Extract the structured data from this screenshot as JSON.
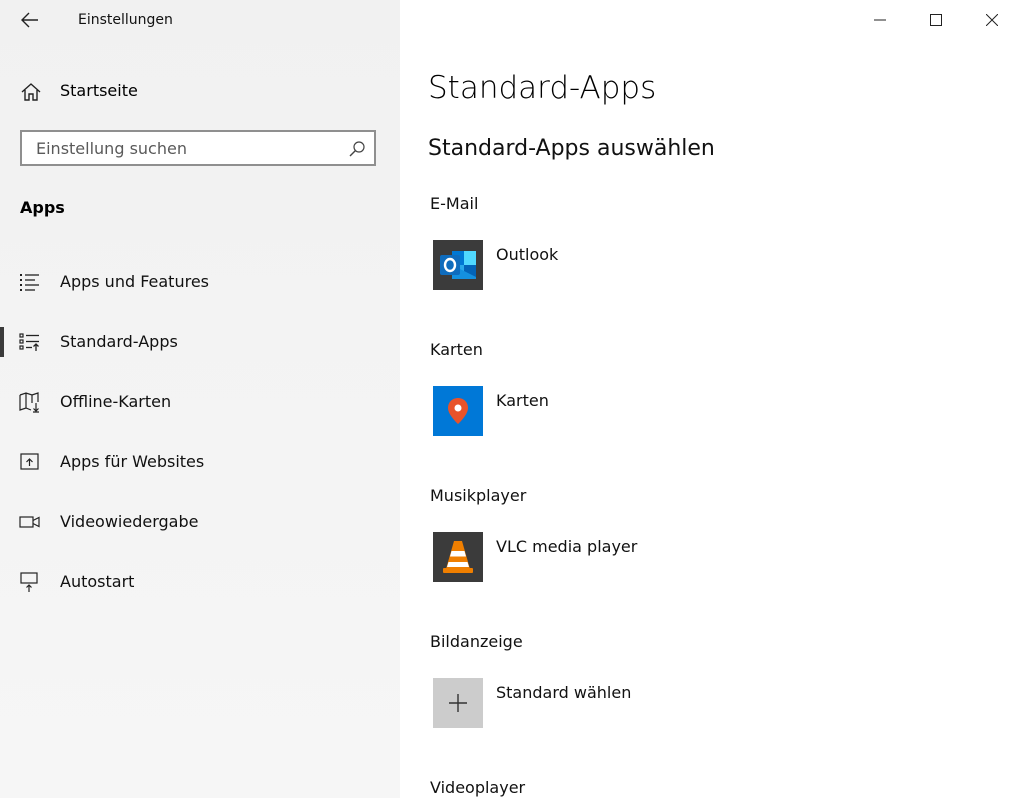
{
  "window": {
    "title": "Einstellungen"
  },
  "sidebar": {
    "home_label": "Startseite",
    "search_placeholder": "Einstellung suchen",
    "section_title": "Apps",
    "items": [
      {
        "label": "Apps und Features",
        "icon": "list-icon",
        "active": false
      },
      {
        "label": "Standard-Apps",
        "icon": "default-apps-icon",
        "active": true
      },
      {
        "label": "Offline-Karten",
        "icon": "map-download-icon",
        "active": false
      },
      {
        "label": "Apps für Websites",
        "icon": "open-external-icon",
        "active": false
      },
      {
        "label": "Videowiedergabe",
        "icon": "video-camera-icon",
        "active": false
      },
      {
        "label": "Autostart",
        "icon": "startup-icon",
        "active": false
      }
    ]
  },
  "main": {
    "title": "Standard-Apps",
    "subtitle": "Standard-Apps auswählen",
    "categories": [
      {
        "label": "E-Mail",
        "app": "Outlook",
        "icon": "outlook-icon"
      },
      {
        "label": "Karten",
        "app": "Karten",
        "icon": "maps-icon"
      },
      {
        "label": "Musikplayer",
        "app": "VLC media player",
        "icon": "vlc-icon"
      },
      {
        "label": "Bildanzeige",
        "app": "Standard wählen",
        "icon": "plus-icon"
      },
      {
        "label": "Videoplayer"
      }
    ]
  },
  "colors": {
    "accent": "#0078d7",
    "outlook_blue": "#0f6cbd",
    "maps_blue": "#0078d7",
    "pin_red": "#e8532a",
    "vlc_orange": "#f07f00"
  }
}
